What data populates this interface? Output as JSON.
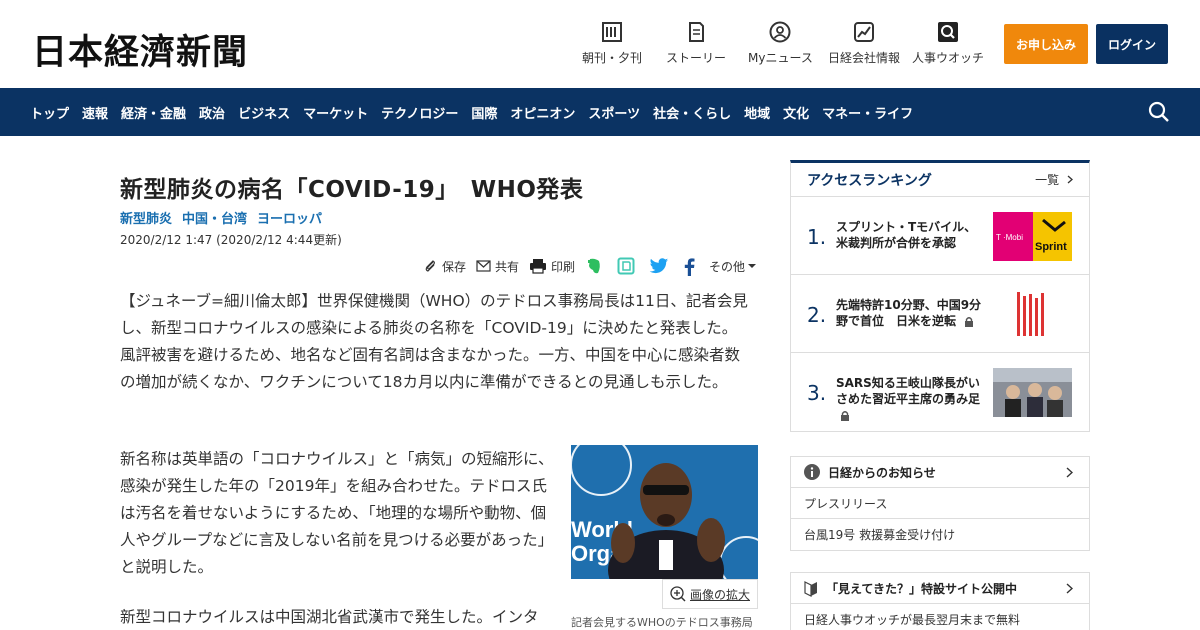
{
  "header": {
    "logo": "日本経濟新聞",
    "utils": [
      {
        "label": "朝刊・夕刊",
        "icon": "newspaper-icon"
      },
      {
        "label": "ストーリー",
        "icon": "document-icon"
      },
      {
        "label": "Myニュース",
        "icon": "user-icon"
      },
      {
        "label": "日経会社情報",
        "icon": "chart-icon"
      },
      {
        "label": "人事ウオッチ",
        "icon": "search-person-icon"
      }
    ],
    "apply_label": "お申し込み",
    "login_label": "ログイン",
    "colors": {
      "nav": "#0b3363",
      "apply": "#f0880c",
      "login": "#0a3161"
    }
  },
  "nav": {
    "items": [
      "トップ",
      "速報",
      "経済・金融",
      "政治",
      "ビジネス",
      "マーケット",
      "テクノロジー",
      "国際",
      "オピニオン",
      "スポーツ",
      "社会・くらし",
      "地域",
      "文化",
      "マネー・ライフ"
    ]
  },
  "article": {
    "title": "新型肺炎の病名「COVID-19」　WHO発表",
    "tags": [
      "新型肺炎",
      "中国・台湾",
      "ヨーロッパ"
    ],
    "date": "2020/2/12 1:47 (2020/2/12 4:44更新)",
    "share": {
      "save": "保存",
      "share": "共有",
      "print": "印刷",
      "other": "その他"
    },
    "p1": "【ジュネーブ=細川倫太郎】世界保健機関（WHO）のテドロス事務局長は11日、記者会見し、新型コロナウイルスの感染による肺炎の名称を「COVID-19」に決めたと発表した。風評被害を避けるため、地名など固有名詞は含まなかった。一方、中国を中心に感染者数の増加が続くなか、ワクチンについて18カ月以内に準備ができるとの見通しも示した。",
    "p2": "新名称は英単語の「コロナウイルス」と「病気」の短縮形に、感染が発生した年の「2019年」を組み合わせた。テドロス氏は汚名を着せないようにするため、「地理的な場所や動物、個人やグループなどに言及しない名前を見つける必要があった」と説明した。",
    "p3": "新型コロナウイルスは中国湖北省武漢市で発生した。インタ",
    "zoom_label": "画像の拡大",
    "caption": "記者会見するWHOのテドロス事務局"
  },
  "ranking": {
    "title": "アクセスランキング",
    "more": "一覧",
    "items": [
      {
        "num": "1.",
        "text": "スプリント・Tモバイル、米裁判所が合併を承認",
        "locked": false
      },
      {
        "num": "2.",
        "text": "先端特許10分野、中国9分野で首位　日米を逆転",
        "locked": true
      },
      {
        "num": "3.",
        "text": "SARS知る王岐山隊長がいさめた習近平主席の勇み足",
        "locked": true
      }
    ]
  },
  "notices": {
    "head": "日経からのお知らせ",
    "items": [
      "プレスリリース",
      "台風19号 救援募金受け付け"
    ]
  },
  "notices2": {
    "head": "「見えてきた？」特設サイト公開中",
    "items": [
      "日経人事ウオッチが最長翌月末まで無料"
    ]
  }
}
